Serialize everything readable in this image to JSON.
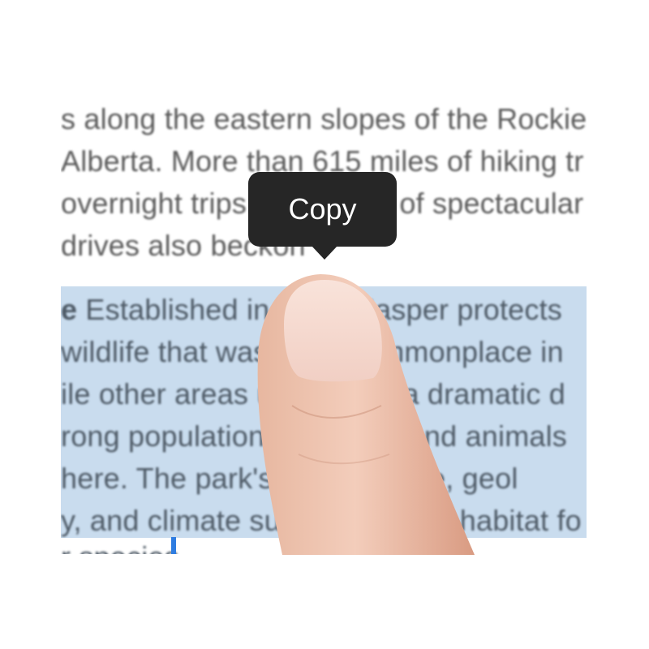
{
  "document": {
    "unselected_lines": [
      "s along the eastern slopes of the Rockies",
      "Alberta. More than 615 miles of hiking tr",
      "overnight trips. Hundreds of spectacular",
      "drives also beckon"
    ],
    "selected_lines": [
      {
        "prefix": "e",
        "text": " Established in 1907, Jasper protects"
      },
      {
        "prefix": "",
        "text": " wildlife that was once commonplace in"
      },
      {
        "prefix": "",
        "text": "ile other areas underwent a dramatic d"
      },
      {
        "prefix": "",
        "text": "rong populations of plants and animals"
      },
      {
        "prefix": "",
        "text": " here. The park's varied range, geol"
      },
      {
        "prefix": "",
        "text": "y, and climate support diverse habitat fo"
      },
      {
        "prefix": "",
        "text": "r species."
      }
    ]
  },
  "context_menu": {
    "copy_label": "Copy"
  },
  "colors": {
    "selection": "#c9dcee",
    "caret": "#2f7de1",
    "menu_background": "#262626"
  }
}
